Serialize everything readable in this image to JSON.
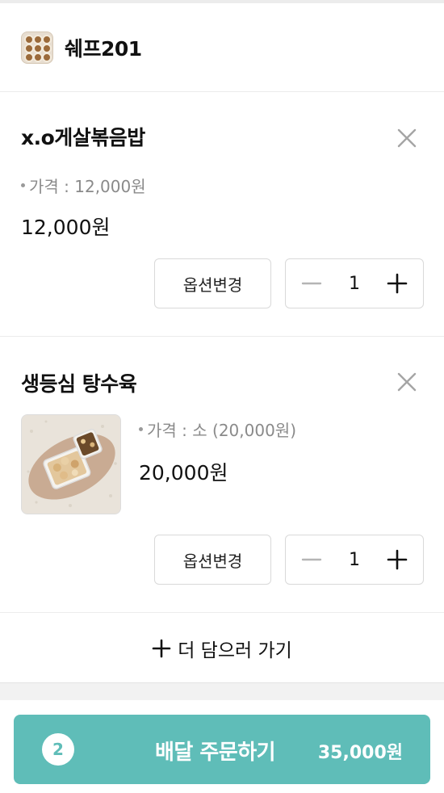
{
  "store": {
    "name": "쉐프201",
    "logo_icon": "food-dish-icon"
  },
  "items": [
    {
      "name": "x.o게살볶음밥",
      "option": "가격 : 12,000원",
      "price": "12,000원",
      "quantity": "1",
      "option_change_label": "옵션변경",
      "has_image": false
    },
    {
      "name": "생등심 탕수육",
      "option": "가격 : 소 (20,000원)",
      "price": "20,000원",
      "quantity": "1",
      "option_change_label": "옵션변경",
      "has_image": true
    }
  ],
  "add_more_label": "더 담으러 가기",
  "order": {
    "count": "2",
    "label": "배달 주문하기",
    "total": "35,000원"
  },
  "colors": {
    "accent": "#5fbdb8",
    "divider": "#ececec"
  }
}
